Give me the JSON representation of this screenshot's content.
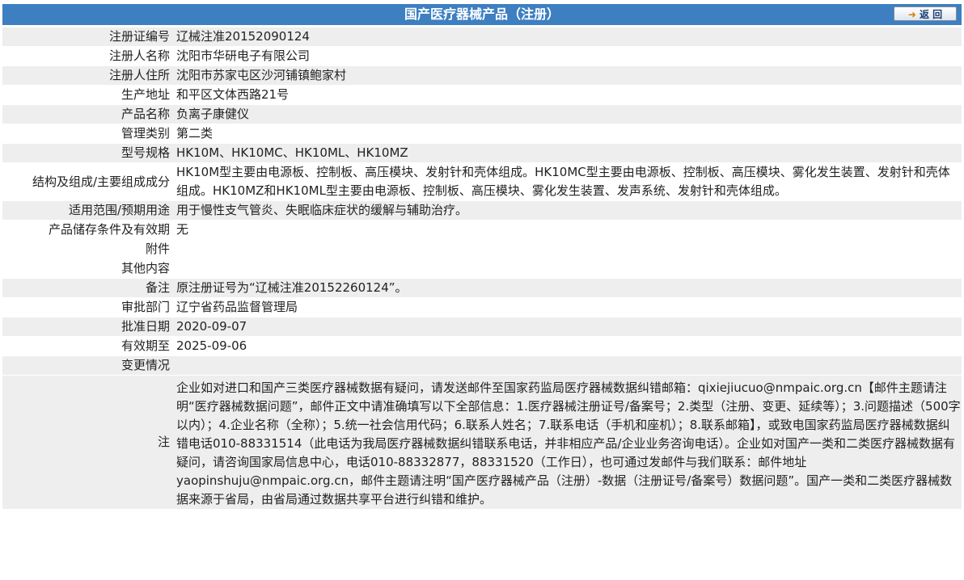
{
  "header": {
    "title": "国产医疗器械产品（注册）",
    "back_label": "返 回"
  },
  "rows": [
    {
      "label": "注册证编号",
      "value": "辽械注准20152090124"
    },
    {
      "label": "注册人名称",
      "value": "沈阳市华研电子有限公司"
    },
    {
      "label": "注册人住所",
      "value": "沈阳市苏家屯区沙河铺镇鲍家村"
    },
    {
      "label": "生产地址",
      "value": "和平区文体西路21号"
    },
    {
      "label": "产品名称",
      "value": "负离子康健仪"
    },
    {
      "label": "管理类别",
      "value": "第二类"
    },
    {
      "label": "型号规格",
      "value": "HK10M、HK10MC、HK10ML、HK10MZ"
    },
    {
      "label": "结构及组成/主要组成成分",
      "value": "HK10M型主要由电源板、控制板、高压模块、发射针和壳体组成。HK10MC型主要由电源板、控制板、高压模块、雾化发生装置、发射针和壳体组成。HK10MZ和HK10ML型主要由电源板、控制板、高压模块、雾化发生装置、发声系统、发射针和壳体组成。"
    },
    {
      "label": "适用范围/预期用途",
      "value": "用于慢性支气管炎、失眠临床症状的缓解与辅助治疗。"
    },
    {
      "label": "产品储存条件及有效期",
      "value": "无"
    },
    {
      "label": "附件",
      "value": ""
    },
    {
      "label": "其他内容",
      "value": ""
    },
    {
      "label": "备注",
      "value": "原注册证号为“辽械注准20152260124”。"
    },
    {
      "label": "审批部门",
      "value": "辽宁省药品监督管理局"
    },
    {
      "label": "批准日期",
      "value": "2020-09-07"
    },
    {
      "label": "有效期至",
      "value": "2025-09-06"
    },
    {
      "label": "变更情况",
      "value": ""
    },
    {
      "label": "注",
      "value": "企业如对进口和国产三类医疗器械数据有疑问，请发送邮件至国家药监局医疗器械数据纠错邮箱：qixiejiucuo@nmpaic.org.cn【邮件主题请注明“医疗器械数据问题”，邮件正文中请准确填写以下全部信息：1.医疗器械注册证号/备案号；2.类型（注册、变更、延续等）；3.问题描述（500字以内）；4.企业名称（全称）；5.统一社会信用代码；6.联系人姓名；7.联系电话（手机和座机）；8.联系邮箱】，或致电国家药监局医疗器械数据纠错电话010-88331514（此电话为我局医疗器械数据纠错联系电话，并非相应产品/企业业务咨询电话）。企业如对国产一类和二类医疗器械数据有疑问，请咨询国家局信息中心，电话010-88332877，88331520（工作日），也可通过发邮件与我们联系：邮件地址yaopinshuju@nmpaic.org.cn，邮件主题请注明“国产医疗器械产品（注册）-数据（注册证号/备案号）数据问题”。国产一类和二类医疗器械数据来源于省局，由省局通过数据共享平台进行纠错和维护。"
    }
  ]
}
